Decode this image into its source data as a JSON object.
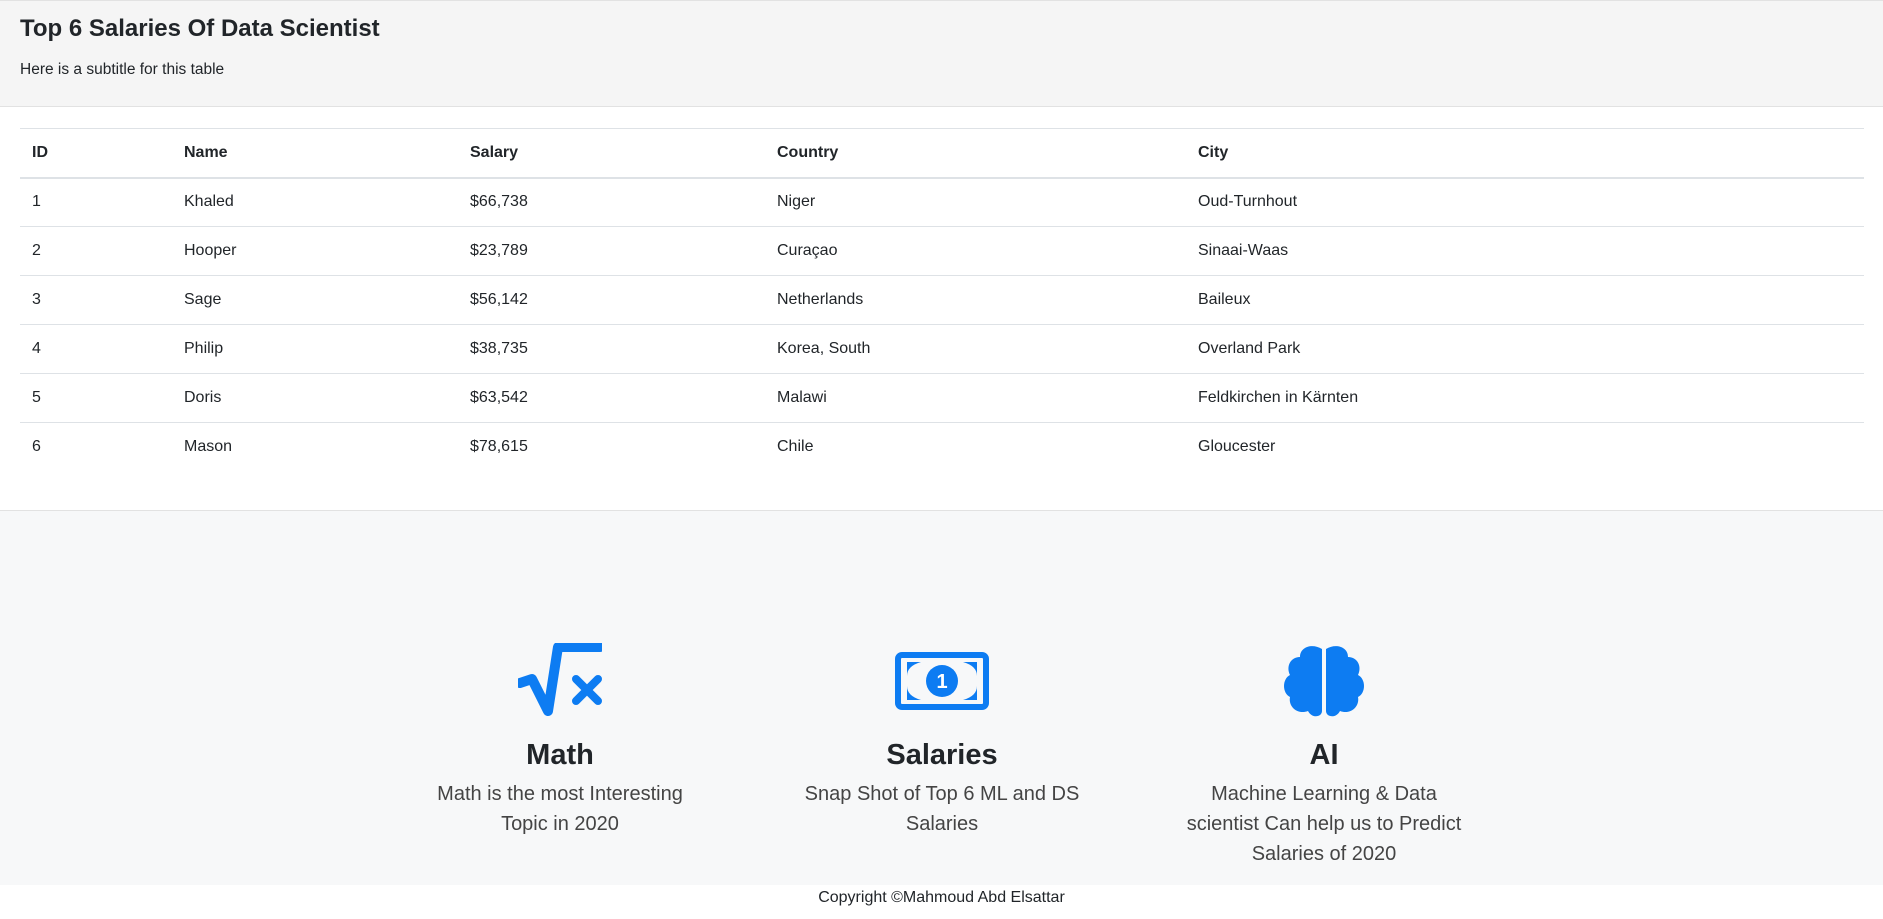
{
  "card": {
    "title": "Top 6 Salaries Of Data Scientist",
    "subtitle": "Here is a subtitle for this table"
  },
  "table": {
    "headers": [
      "ID",
      "Name",
      "Salary",
      "Country",
      "City"
    ],
    "rows": [
      [
        "1",
        "Khaled",
        "$66,738",
        "Niger",
        "Oud-Turnhout"
      ],
      [
        "2",
        "Hooper",
        "$23,789",
        "Curaçao",
        "Sinaai-Waas"
      ],
      [
        "3",
        "Sage",
        "$56,142",
        "Netherlands",
        "Baileux"
      ],
      [
        "4",
        "Philip",
        "$38,735",
        "Korea, South",
        "Overland Park"
      ],
      [
        "5",
        "Doris",
        "$63,542",
        "Malawi",
        "Feldkirchen in Kärnten"
      ],
      [
        "6",
        "Mason",
        "$78,615",
        "Chile",
        "Gloucester"
      ]
    ]
  },
  "features": [
    {
      "icon": "square-root-icon",
      "title": "Math",
      "text": "Math is the most Interesting Topic in 2020"
    },
    {
      "icon": "money-bill-icon",
      "title": "Salaries",
      "text": "Snap Shot of Top 6 ML and DS Salaries"
    },
    {
      "icon": "brain-icon",
      "title": "AI",
      "text": "Machine Learning & Data scientist Can help us to Predict Salaries of 2020"
    }
  ],
  "footer": {
    "copyright": "Copyright ©Mahmoud Abd Elsattar"
  },
  "colors": {
    "accent": "#0d7cf2",
    "header_bg": "#f5f5f5",
    "features_bg": "#f7f8f9"
  }
}
